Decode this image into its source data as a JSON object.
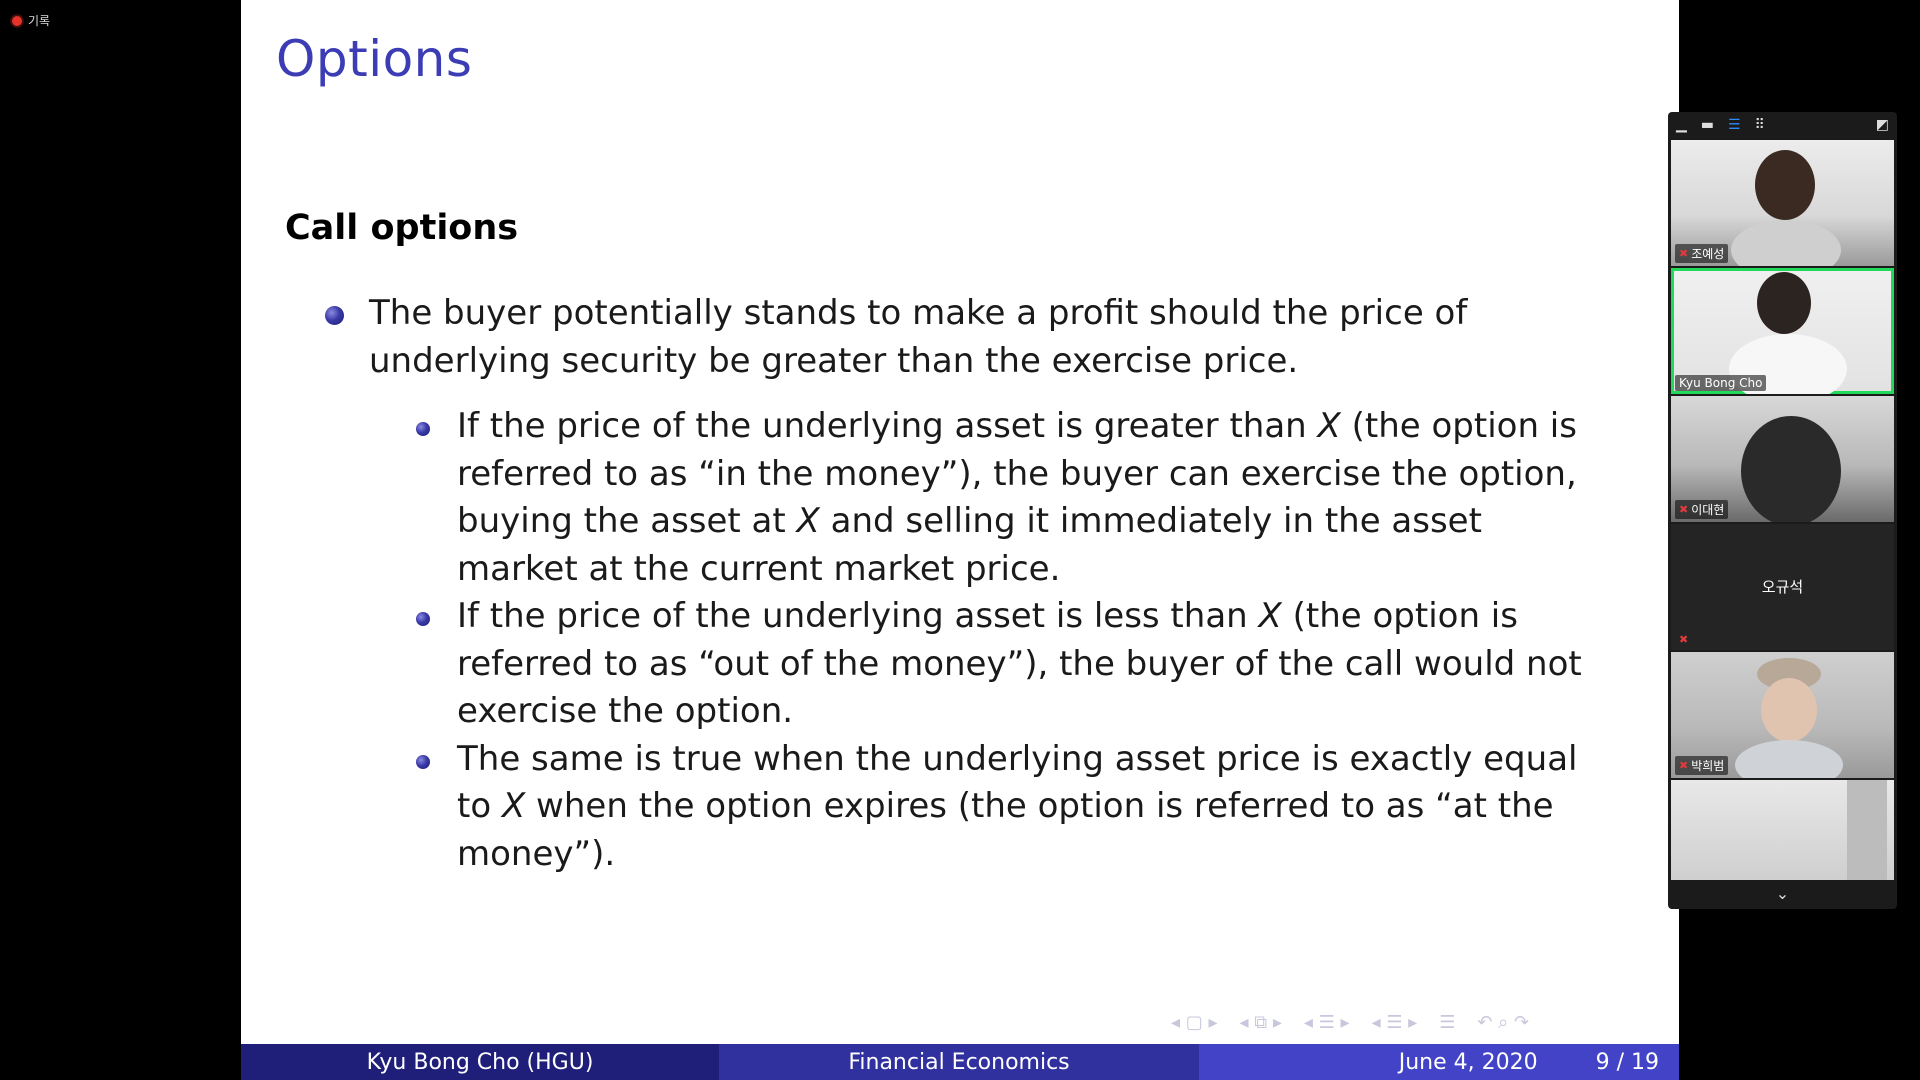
{
  "recording": {
    "label": "기록"
  },
  "slide": {
    "title": "Options",
    "section_heading": "Call options",
    "bullet_main": "The buyer potentially stands to make a profit should the price of underlying security be greater than the exercise price.",
    "sub_bullets": [
      {
        "before": "If the price of the underlying asset is greater than ",
        "var": "X",
        "after": " (the option is referred to as “in the money”), the buyer can exercise the option, buying the asset at ",
        "var2": "X",
        "after2": " and selling it immediately in the asset market at the current market price."
      },
      {
        "before": "If the price of the underlying asset is less than ",
        "var": "X",
        "after": " (the option is referred to as “out of the money”), the buyer of the call would not exercise the option."
      },
      {
        "before": "The same is true when the underlying asset price is exactly equal to ",
        "var": "X",
        "after": " when the option expires (the option is referred to as “at the money”)."
      }
    ]
  },
  "footer": {
    "author": "Kyu Bong Cho  (HGU)",
    "course": "Financial Economics",
    "date": "June 4, 2020",
    "page": "9 / 19"
  },
  "participants": [
    {
      "name": "조예성",
      "muted": true,
      "speaking": false
    },
    {
      "name": "Kyu Bong Cho",
      "muted": false,
      "speaking": true
    },
    {
      "name": "이대현",
      "muted": true,
      "speaking": false
    },
    {
      "name": "오규석",
      "muted": true,
      "speaking": false,
      "video": false
    },
    {
      "name": "박희범",
      "muted": true,
      "speaking": false
    },
    {
      "name": "",
      "muted": false,
      "speaking": false
    }
  ],
  "icons": {
    "recording": "record-dot-icon",
    "mic_muted": "mic-muted-icon",
    "chevron": "chevron-down-icon"
  },
  "colors": {
    "title": "#3c3cb4",
    "footer_left": "#1f1f7a",
    "footer_mid": "#30309e",
    "footer_right": "#4343c8",
    "speaking_border": "#23d959",
    "muted_icon": "#e03a3a"
  }
}
